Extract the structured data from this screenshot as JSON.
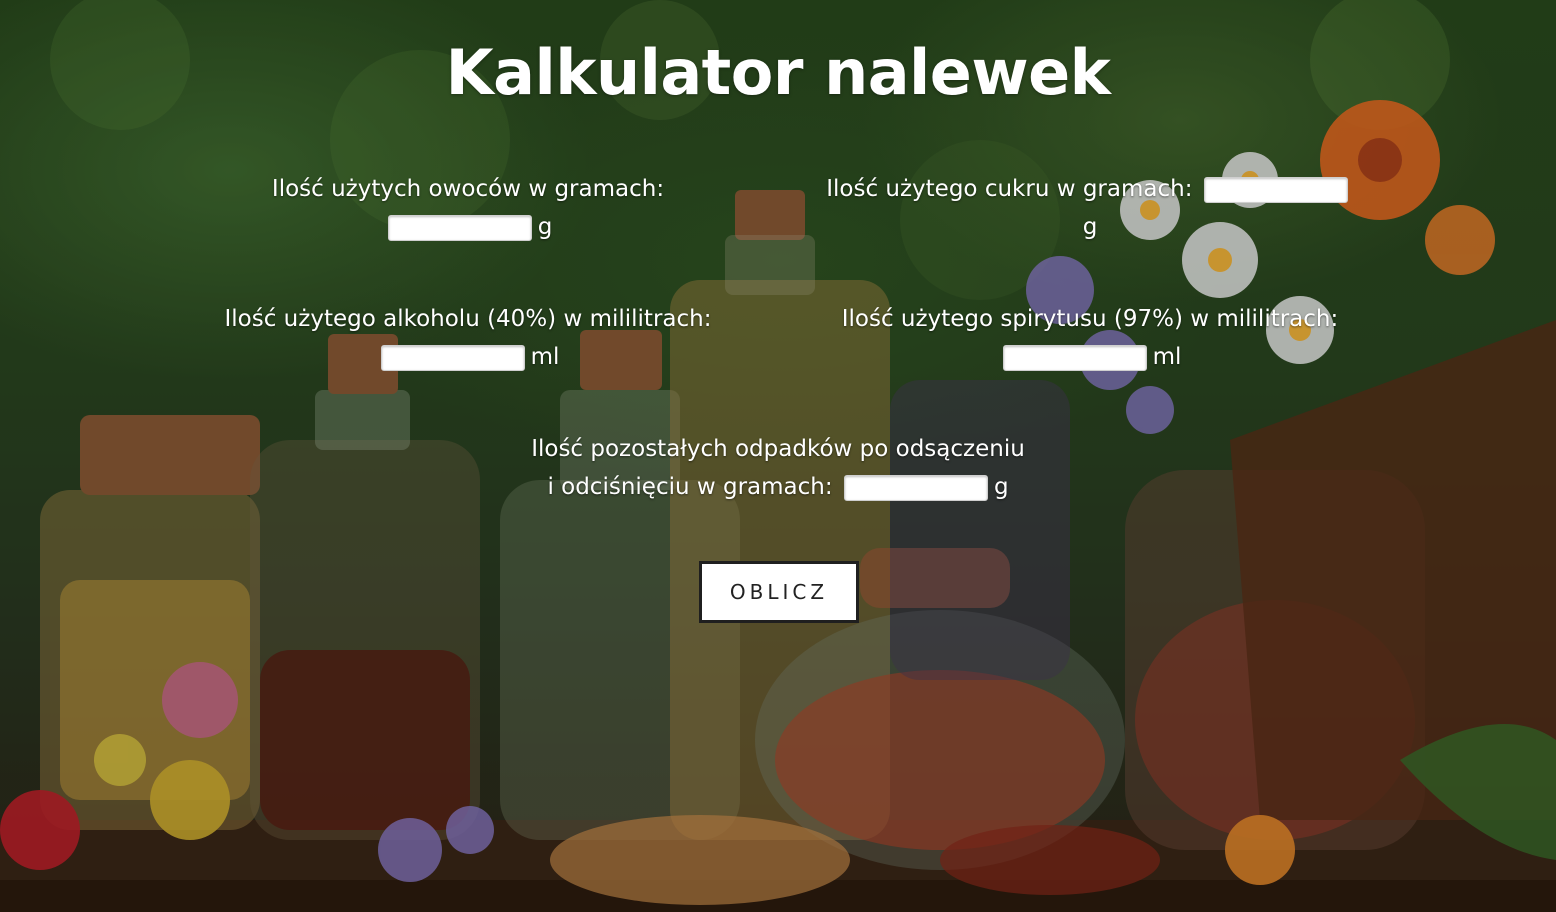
{
  "page": {
    "title": "Kalkulator nalewek"
  },
  "fields": {
    "fruit": {
      "label": "Ilość użytych owoców w gramach:",
      "value": "",
      "unit": "g"
    },
    "sugar": {
      "label": "Ilość użytego cukru w gramach:",
      "value": "",
      "unit": "g"
    },
    "alcohol": {
      "label": "Ilość użytego alkoholu (40%) w mililitrach:",
      "value": "",
      "unit": "ml"
    },
    "spirit": {
      "label": "Ilość użytego spirytusu (97%) w mililitrach:",
      "value": "",
      "unit": "ml"
    },
    "waste": {
      "label_line1": "Ilość pozostałych odpadków po odsączeniu",
      "label_line2": "i odciśnięciu w gramach:",
      "value": "",
      "unit": "g"
    }
  },
  "actions": {
    "calculate_label": "OBLICZ"
  },
  "background": {
    "description_icon": "herbal-bottles-photo"
  },
  "colors": {
    "text": "#ffffff",
    "button_bg": "#ffffff",
    "button_border": "#1f1f1f",
    "button_text": "#222222"
  }
}
